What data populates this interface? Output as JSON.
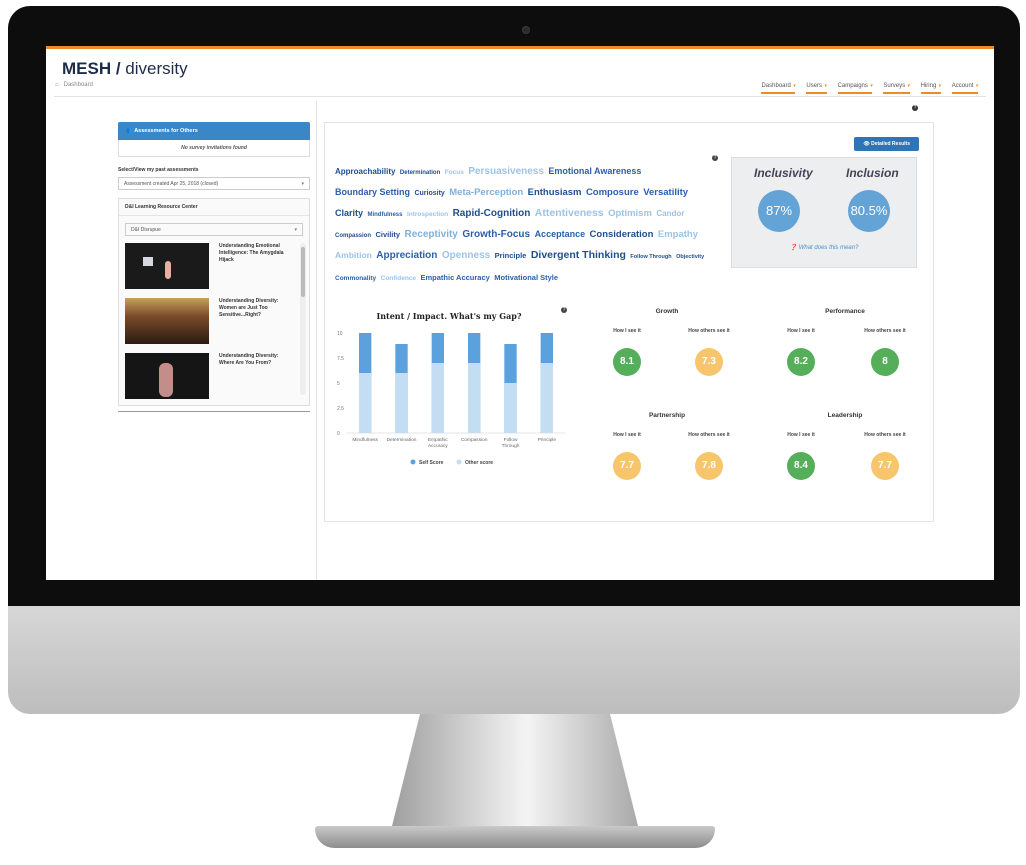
{
  "app": {
    "brand": "MESH",
    "slash": " / ",
    "sub": "diversity"
  },
  "breadcrumb": {
    "home": "Dashboard"
  },
  "nav": [
    {
      "label": "Dashboard"
    },
    {
      "label": "Users"
    },
    {
      "label": "Campaigns"
    },
    {
      "label": "Surveys"
    },
    {
      "label": "Hiring"
    },
    {
      "label": "Account"
    }
  ],
  "nav_caret": "▾",
  "left": {
    "assess_title": "Assessments for Others",
    "no_invites": "No survey invitations found",
    "past_label": "Select/View my past assessments",
    "past_selected": "Assessment created Apr 25, 2018 (closed)",
    "resource_title": "D&I Learning Resource Center",
    "resource_selected": "D&I Disrupue",
    "videos": [
      {
        "title": "Understanding Emotional Intelligence: The Amygdala Hijack"
      },
      {
        "title": "Understanding Diversity: Women are Just Too Sensitive...Right?"
      },
      {
        "title": "Understanding Diversity: Where Are You From?"
      }
    ]
  },
  "detailed_button": "Detailed Results",
  "word_cloud": [
    {
      "text": "Approachability",
      "size": 8,
      "color": "#1f4e8c"
    },
    {
      "text": "Determination",
      "size": 6,
      "color": "#1f4e8c"
    },
    {
      "text": "Focus",
      "size": 6.5,
      "color": "#9cc3e6"
    },
    {
      "text": "Persuasiveness",
      "size": 10,
      "color": "#9cc3e6"
    },
    {
      "text": "Emotional Awareness",
      "size": 9,
      "color": "#2b5fa8"
    },
    {
      "text": "Boundary Setting",
      "size": 9,
      "color": "#2b5fa8"
    },
    {
      "text": "Curiosity",
      "size": 7,
      "color": "#1f4e8c"
    },
    {
      "text": "Meta-Perception",
      "size": 9.5,
      "color": "#7eb0dc"
    },
    {
      "text": "Enthusiasm",
      "size": 9.5,
      "color": "#1f4e8c"
    },
    {
      "text": "Composure",
      "size": 9.5,
      "color": "#2b5fa8"
    },
    {
      "text": "Versatility",
      "size": 9.5,
      "color": "#2b5fa8"
    },
    {
      "text": "Clarity",
      "size": 9,
      "color": "#1f4e8c"
    },
    {
      "text": "Mindfulness",
      "size": 6,
      "color": "#2b5fa8"
    },
    {
      "text": "Introspection",
      "size": 6.5,
      "color": "#9cc3e6"
    },
    {
      "text": "Rapid-Cognition",
      "size": 10,
      "color": "#1f4e8c"
    },
    {
      "text": "Attentiveness",
      "size": 10.5,
      "color": "#9cc3e6"
    },
    {
      "text": "Optimism",
      "size": 9.5,
      "color": "#9cc3e6"
    },
    {
      "text": "Candor",
      "size": 8,
      "color": "#9cc3e6"
    },
    {
      "text": "Compassion",
      "size": 6,
      "color": "#1f4e8c"
    },
    {
      "text": "Civility",
      "size": 7.5,
      "color": "#1f4e8c"
    },
    {
      "text": "Receptivity",
      "size": 10,
      "color": "#7eb0dc"
    },
    {
      "text": "Growth-Focus",
      "size": 10,
      "color": "#2b5fa8"
    },
    {
      "text": "Acceptance",
      "size": 9,
      "color": "#2b5fa8"
    },
    {
      "text": "Consideration",
      "size": 9.5,
      "color": "#1f4e8c"
    },
    {
      "text": "Empathy",
      "size": 9.5,
      "color": "#9cc3e6"
    },
    {
      "text": "Ambition",
      "size": 8.5,
      "color": "#9cc3e6"
    },
    {
      "text": "Appreciation",
      "size": 10,
      "color": "#2b5fa8"
    },
    {
      "text": "Openness",
      "size": 10,
      "color": "#9cc3e6"
    },
    {
      "text": "Principle",
      "size": 7.5,
      "color": "#1f4e8c"
    },
    {
      "text": "Divergent Thinking",
      "size": 10.5,
      "color": "#1f4e8c"
    },
    {
      "text": "Follow Through",
      "size": 5.5,
      "color": "#1f4e8c"
    },
    {
      "text": "Objectivity",
      "size": 5.5,
      "color": "#1f4e8c"
    },
    {
      "text": "Commonality",
      "size": 6.5,
      "color": "#2b5fa8"
    },
    {
      "text": "Confidence",
      "size": 6.5,
      "color": "#9cc3e6"
    },
    {
      "text": "Empathic Accuracy",
      "size": 7.5,
      "color": "#2b5fa8"
    },
    {
      "text": "Motivational Style",
      "size": 7.5,
      "color": "#2b5fa8"
    }
  ],
  "inclusivity": {
    "h1": "Inclusivity",
    "v1": "87%",
    "h2": "Inclusion",
    "v2": "80.5%",
    "meaning": "What does this mean?"
  },
  "chart_data": {
    "type": "bar",
    "title": "Intent / Impact. What's my Gap?",
    "categories": [
      "Mindfulness",
      "Determination",
      "Empathic Accuracy",
      "Compassion",
      "Follow Through",
      "Principle"
    ],
    "category_lines": [
      [
        "Mindfulness"
      ],
      [
        "Determination"
      ],
      [
        "Empathic",
        "Accuracy"
      ],
      [
        "Compassion"
      ],
      [
        "Follow",
        "Through"
      ],
      [
        "Principle"
      ]
    ],
    "series": [
      {
        "name": "Self Score",
        "values": [
          10,
          8.9,
          10,
          10,
          8.9,
          10
        ],
        "color": "#5aa1dd"
      },
      {
        "name": "Other score",
        "values": [
          6,
          6,
          7,
          7,
          5,
          7
        ],
        "color": "#c3ddf3"
      }
    ],
    "ylim": [
      0,
      10
    ],
    "yticks": [
      "0",
      "2.5",
      "5",
      "7.5",
      "10"
    ],
    "legend_position": "bottom",
    "grid": false
  },
  "scores": {
    "growth": {
      "title": "Growth",
      "self_label": "How I see it",
      "self": "8.1",
      "self_color": "#55ae5a",
      "others_label": "How others see it",
      "others": "7.3",
      "others_color": "#f7c56b"
    },
    "performance": {
      "title": "Performance",
      "self_label": "How I see it",
      "self": "8.2",
      "self_color": "#55ae5a",
      "others_label": "How others see it",
      "others": "8",
      "others_color": "#55ae5a"
    },
    "partnership": {
      "title": "Partnership",
      "self_label": "How I see it",
      "self": "7.7",
      "self_color": "#f7c56b",
      "others_label": "How others see it",
      "others": "7.8",
      "others_color": "#f7c56b"
    },
    "leadership": {
      "title": "Leadership",
      "self_label": "How I see it",
      "self": "8.4",
      "self_color": "#55ae5a",
      "others_label": "How others see it",
      "others": "7.7",
      "others_color": "#f7c56b"
    }
  }
}
